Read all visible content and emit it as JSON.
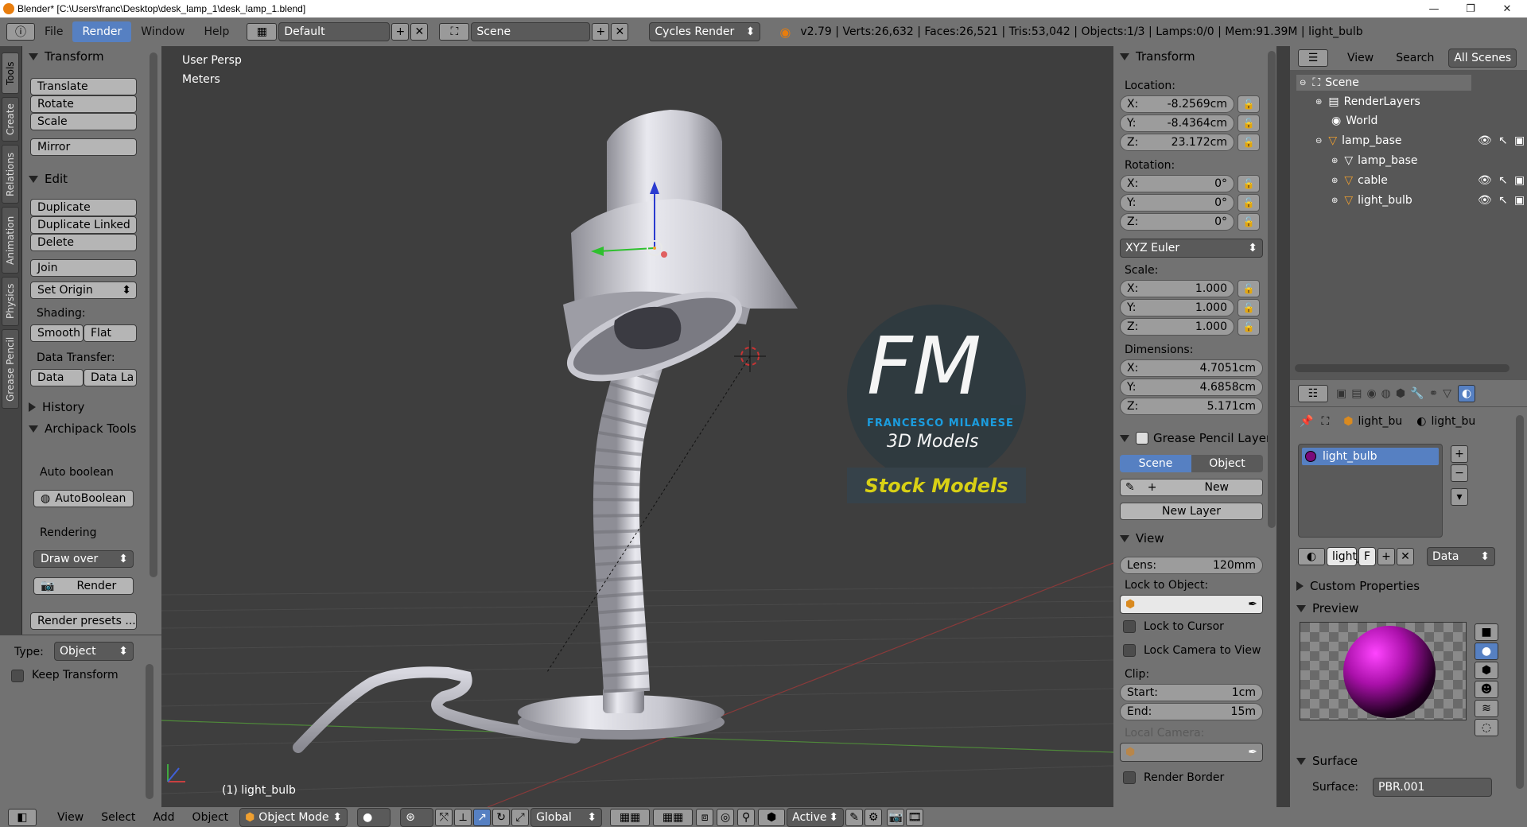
{
  "window": {
    "title": "Blender* [C:\\Users\\franc\\Desktop\\desk_lamp_1\\desk_lamp_1.blend]",
    "minimize": "—",
    "restore": "❐",
    "close": "✕"
  },
  "topbar": {
    "menus": [
      "File",
      "Render",
      "Window",
      "Help"
    ],
    "screen_layout": "Default",
    "scene": "Scene",
    "engine": "Cycles Render",
    "stats": "v2.79 | Verts:26,632 | Faces:26,521 | Tris:53,042 | Objects:1/3 | Lamps:0/0 | Mem:91.39M | light_bulb"
  },
  "left_tabs": [
    "Tools",
    "Create",
    "Relations",
    "Animation",
    "Physics",
    "Grease Pencil"
  ],
  "tool_panel": {
    "transform_header": "Transform",
    "translate": "Translate",
    "rotate": "Rotate",
    "scale": "Scale",
    "mirror": "Mirror",
    "edit_header": "Edit",
    "duplicate": "Duplicate",
    "duplicate_linked": "Duplicate Linked",
    "delete": "Delete",
    "join": "Join",
    "set_origin": "Set Origin",
    "shading_label": "Shading:",
    "smooth": "Smooth",
    "flat": "Flat",
    "data_transfer_label": "Data Transfer:",
    "data": "Data",
    "data_la": "Data La",
    "history_header": "History",
    "archipack_header": "Archipack Tools",
    "auto_boolean_label": "Auto boolean",
    "auto_boolean_btn": "AutoBoolean",
    "rendering_label": "Rendering",
    "draw_over": "Draw over",
    "render_btn": "Render",
    "render_presets": "Render presets ...",
    "type_label": "Type:",
    "type_value": "Object",
    "keep_transform": "Keep Transform"
  },
  "viewport": {
    "view_name": "User Persp",
    "units": "Meters",
    "object_label": "(1) light_bulb",
    "logo_letters": "FM",
    "logo_name": "FRANCESCO MILANESE",
    "logo_sub": "3D Models",
    "logo_banner": "Stock Models"
  },
  "n_panel": {
    "transform_header": "Transform",
    "location_label": "Location:",
    "loc_x": "-8.2569cm",
    "loc_y": "-8.4364cm",
    "loc_z": "23.172cm",
    "rotation_label": "Rotation:",
    "rot_x": "0°",
    "rot_y": "0°",
    "rot_z": "0°",
    "rotation_mode": "XYZ Euler",
    "scale_label": "Scale:",
    "scale_x": "1.000",
    "scale_y": "1.000",
    "scale_z": "1.000",
    "dimensions_label": "Dimensions:",
    "dim_x": "4.7051cm",
    "dim_y": "4.6858cm",
    "dim_z": "5.171cm",
    "gp_header": "Grease Pencil Layer",
    "gp_scene": "Scene",
    "gp_object": "Object",
    "gp_new": "New",
    "gp_new_layer": "New Layer",
    "view_header": "View",
    "lens_label": "Lens:",
    "lens_value": "120mm",
    "lock_to_object": "Lock to Object:",
    "lock_to_cursor": "Lock to Cursor",
    "lock_camera": "Lock Camera to View",
    "clip_label": "Clip:",
    "clip_start_label": "Start:",
    "clip_start": "1cm",
    "clip_end_label": "End:",
    "clip_end": "15m",
    "local_camera": "Local Camera:",
    "render_border": "Render Border",
    "axis_x": "X:",
    "axis_y": "Y:",
    "axis_z": "Z:"
  },
  "outliner": {
    "view": "View",
    "search": "Search",
    "filter": "All Scenes",
    "items": [
      "Scene",
      "RenderLayers",
      "World",
      "lamp_base",
      "lamp_base",
      "cable",
      "light_bulb"
    ]
  },
  "properties": {
    "crumb_object": "light_bu",
    "crumb_material": "light_bu",
    "material_slot": "light_bulb",
    "mat_field": "light_",
    "mat_f": "F",
    "data_dropdown": "Data",
    "custom_props": "Custom Properties",
    "preview": "Preview",
    "surface_header": "Surface",
    "surface_label": "Surface:",
    "surface_value": "PBR.001"
  },
  "bottombar": {
    "view": "View",
    "select": "Select",
    "add": "Add",
    "object": "Object",
    "mode": "Object Mode",
    "orientation": "Global",
    "pivot": "Active"
  },
  "colors": {
    "accent": "#5680c2",
    "header_bg": "#727272",
    "viewport_bg": "#3e3e3e",
    "logo_blue": "#1aa3e8",
    "logo_yellow": "#d8d015"
  }
}
